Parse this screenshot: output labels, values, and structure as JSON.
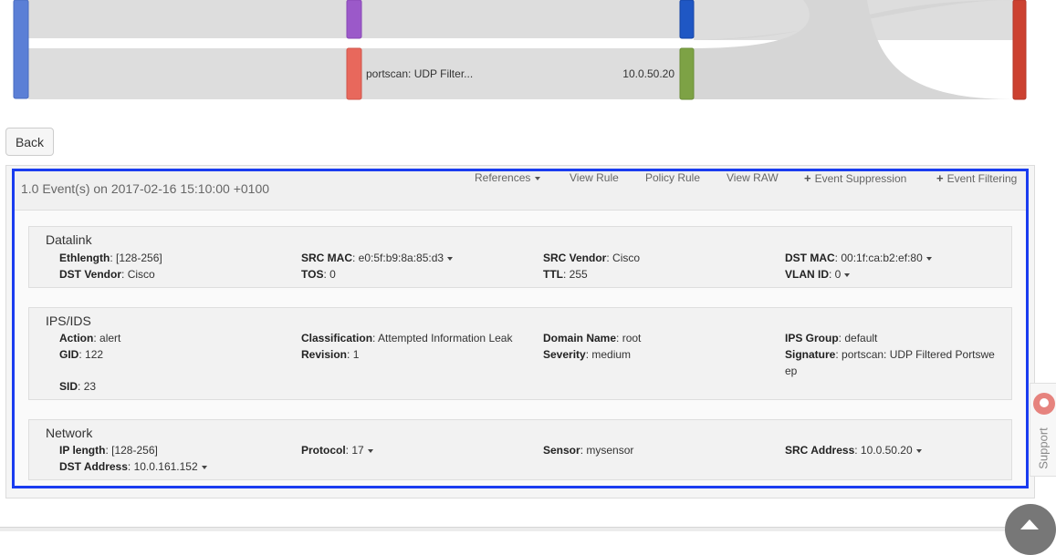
{
  "sankey": {
    "nodes": [
      {
        "id": "n1",
        "color": "#5b7fd6"
      },
      {
        "id": "n2",
        "color": "#9b59c9"
      },
      {
        "id": "n3",
        "color": "#e8685c",
        "label": "portscan: UDP Filter..."
      },
      {
        "id": "n4",
        "color": "#1f57c4"
      },
      {
        "id": "n5",
        "color": "#7da245",
        "label": "10.0.50.20"
      },
      {
        "id": "n6",
        "color": "#cc4130"
      }
    ],
    "link_color": "#dcdcdc"
  },
  "back_label": "Back",
  "event": {
    "title": "1.0 Event(s) on 2017-02-16 15:10:00 +0100",
    "toolbar": {
      "references": "References",
      "view_rule": "View Rule",
      "policy_rule": "Policy Rule",
      "view_raw": "View RAW",
      "event_suppression": "Event Suppression",
      "event_filtering": "Event Filtering",
      "plus": "+"
    },
    "datalink": {
      "title": "Datalink",
      "fields": [
        {
          "label": "Ethlength",
          "value": "[128-256]"
        },
        {
          "label": "SRC MAC",
          "value": "e0:5f:b9:8a:85:d3",
          "dropdown": true
        },
        {
          "label": "SRC Vendor",
          "value": "Cisco"
        },
        {
          "label": "DST MAC",
          "value": "00:1f:ca:b2:ef:80",
          "dropdown": true
        },
        {
          "label": "DST Vendor",
          "value": "Cisco"
        },
        {
          "label": "TOS",
          "value": "0"
        },
        {
          "label": "TTL",
          "value": "255"
        },
        {
          "label": "VLAN ID",
          "value": "0",
          "dropdown": true
        }
      ]
    },
    "ips": {
      "title": "IPS/IDS",
      "fields": [
        {
          "label": "Action",
          "value": "alert"
        },
        {
          "label": "Classification",
          "value": "Attempted Information Leak"
        },
        {
          "label": "Domain Name",
          "value": "root"
        },
        {
          "label": "IPS Group",
          "value": "default"
        },
        {
          "label": "GID",
          "value": "122"
        },
        {
          "label": "Revision",
          "value": "1"
        },
        {
          "label": "Severity",
          "value": "medium"
        },
        {
          "label": "Signature",
          "value": "portscan: UDP Filtered Portswe",
          "value2": "ep"
        },
        {
          "label": "SID",
          "value": "23"
        }
      ]
    },
    "network": {
      "title": "Network",
      "fields": [
        {
          "label": "IP length",
          "value": "[128-256]"
        },
        {
          "label": "Protocol",
          "value": "17",
          "dropdown": true
        },
        {
          "label": "Sensor",
          "value": "mysensor"
        },
        {
          "label": "SRC Address",
          "value": "10.0.50.20",
          "dropdown": true
        },
        {
          "label": "DST Address",
          "value": "10.0.161.152",
          "dropdown": true
        }
      ]
    }
  },
  "support_label": "Support"
}
